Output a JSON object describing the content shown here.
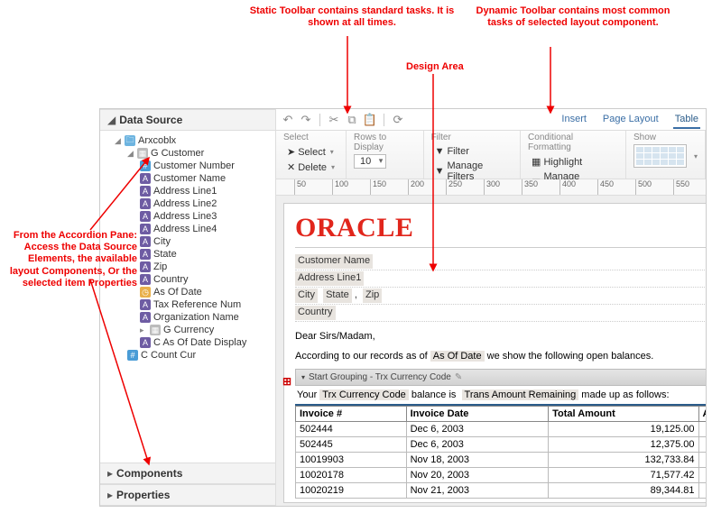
{
  "callouts": {
    "static_toolbar": "Static Toolbar contains standard tasks. It is shown at all times.",
    "dynamic_toolbar": "Dynamic Toolbar contains most common tasks of selected layout component.",
    "design_area": "Design Area",
    "accordion_pane": "From the Accordion Pane: Access the Data Source Elements, the available layout Components, Or the selected item Properties"
  },
  "accordion": {
    "data_source_title": "Data Source",
    "components_title": "Components",
    "properties_title": "Properties",
    "tree": {
      "root": "Arxcoblx",
      "group": "G Customer",
      "items": [
        "Customer Number",
        "Customer Name",
        "Address Line1",
        "Address Line2",
        "Address Line3",
        "Address Line4",
        "City",
        "State",
        "Zip",
        "Country",
        "As Of Date",
        "Tax Reference Num",
        "Organization Name"
      ],
      "sub_group": "G Currency",
      "sub_item": "C As Of Date Display",
      "tail_item": "C Count Cur"
    }
  },
  "tabs": {
    "insert": "Insert",
    "page_layout": "Page Layout",
    "table": "Table"
  },
  "ribbon": {
    "select_lbl": "Select",
    "select_btn": "Select",
    "delete_btn": "Delete",
    "rows_lbl": "Rows to Display",
    "rows_val": "10",
    "filter_lbl": "Filter",
    "filter_btn": "Filter",
    "manage_filters": "Manage Filters",
    "cond_lbl": "Conditional Formatting",
    "highlight": "Highlight",
    "manage_formats": "Manage Formats",
    "show_lbl": "Show"
  },
  "ruler_ticks": [
    "50",
    "100",
    "150",
    "200",
    "250",
    "300",
    "350",
    "400",
    "450",
    "500",
    "550"
  ],
  "doc": {
    "logo": "ORACLE",
    "addr": {
      "customer": "Customer Name",
      "line1": "Address Line1",
      "city": "City",
      "state": "State",
      "zip": "Zip",
      "country": "Country"
    },
    "salutation": "Dear Sirs/Madam,",
    "intro_a": "According to our records as of ",
    "intro_ph": "As Of Date",
    "intro_b": " we show the following open balances.",
    "group_bar": "Start Grouping - Trx Currency Code",
    "sub_a": "Your ",
    "sub_ph1": "Trx Currency Code",
    "sub_b": " balance is ",
    "sub_ph2": "Trans Amount Remaining",
    "sub_c": " made up as follows:",
    "cols": {
      "c1": "Invoice #",
      "c2": "Invoice Date",
      "c3": "Total Amount",
      "c4": "Amount Outs"
    },
    "rows": [
      {
        "inv": "502444",
        "date": "Dec 6, 2003",
        "amt": "19,125.00"
      },
      {
        "inv": "502445",
        "date": "Dec 6, 2003",
        "amt": "12,375.00"
      },
      {
        "inv": "10019903",
        "date": "Nov 18, 2003",
        "amt": "132,733.84"
      },
      {
        "inv": "10020178",
        "date": "Nov 20, 2003",
        "amt": "71,577.42"
      },
      {
        "inv": "10020219",
        "date": "Nov 21, 2003",
        "amt": "89,344.81"
      }
    ]
  }
}
